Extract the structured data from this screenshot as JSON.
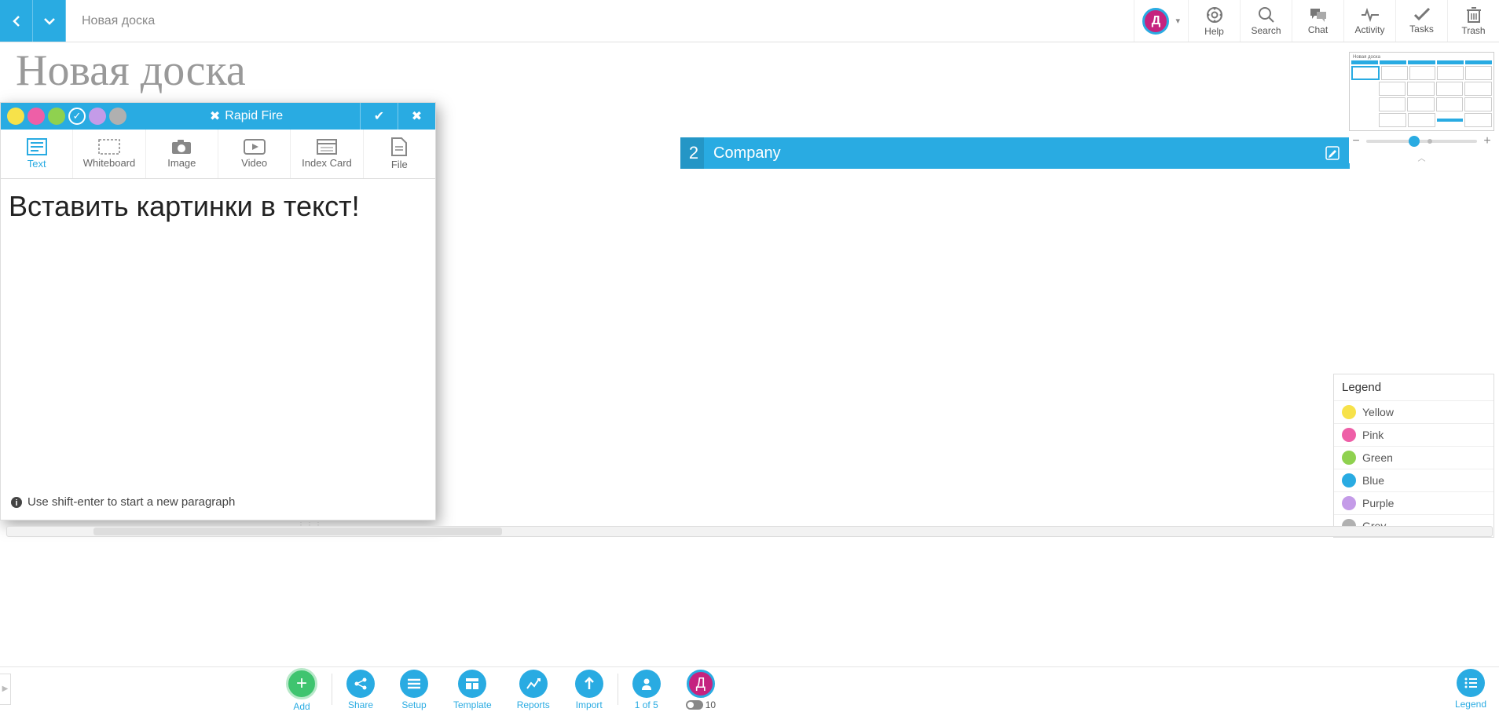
{
  "breadcrumb": "Новая доска",
  "board_title": "Новая доска",
  "top_actions": {
    "help": "Help",
    "search": "Search",
    "chat": "Chat",
    "activity": "Activity",
    "tasks": "Tasks",
    "trash": "Trash"
  },
  "user_avatar_letter": "Д",
  "panel": {
    "title": "Rapid Fire",
    "tabs": {
      "text": "Text",
      "whiteboard": "Whiteboard",
      "image": "Image",
      "video": "Video",
      "index_card": "Index Card",
      "file": "File"
    },
    "body": "Вставить картинки в текст!",
    "hint": "Use shift-enter to start a new paragraph"
  },
  "columns": [
    {
      "num": "2",
      "title": "Company"
    }
  ],
  "legend": {
    "title": "Legend",
    "items": [
      {
        "label": "Yellow",
        "color": "#f7e24a"
      },
      {
        "label": "Pink",
        "color": "#ee5fa7"
      },
      {
        "label": "Green",
        "color": "#8fd14f"
      },
      {
        "label": "Blue",
        "color": "#29abe2"
      },
      {
        "label": "Purple",
        "color": "#c49be8"
      },
      {
        "label": "Grey",
        "color": "#b0b0b0"
      }
    ]
  },
  "colors": {
    "dots": [
      "#f7e24a",
      "#ee5fa7",
      "#8fd14f",
      "#c49be8",
      "#b0b0b0"
    ]
  },
  "bottom": {
    "add": "Add",
    "share": "Share",
    "setup": "Setup",
    "template": "Template",
    "reports": "Reports",
    "import": "Import",
    "presence": "1 of 5",
    "presence_badge": "10",
    "legend": "Legend"
  },
  "minimap_title": "Новая доска"
}
